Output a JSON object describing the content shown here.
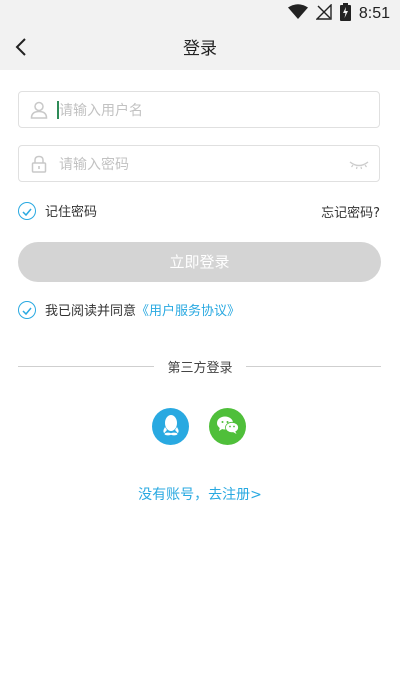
{
  "status_bar": {
    "time": "8:51",
    "icons": [
      "wifi-icon",
      "no-signal-icon",
      "battery-charging-icon"
    ]
  },
  "nav": {
    "title": "登录",
    "back_icon": "chevron-left-icon"
  },
  "username": {
    "placeholder": "请输入用户名",
    "value": "",
    "icon": "user-icon"
  },
  "password": {
    "placeholder": "请输入密码",
    "value": "",
    "icon": "lock-icon",
    "toggle_icon": "eye-closed-icon"
  },
  "remember": {
    "label": "记住密码",
    "checked": true
  },
  "forgot_label": "忘记密码?",
  "login_button_label": "立即登录",
  "agreement": {
    "checked": true,
    "prefix": "我已阅读并同意",
    "link": "《用户服务协议》"
  },
  "third_party": {
    "label": "第三方登录",
    "providers": [
      {
        "name": "QQ",
        "icon": "qq-icon",
        "color": "#29a9e1"
      },
      {
        "name": "WeChat",
        "icon": "wechat-icon",
        "color": "#4fbf3a"
      }
    ]
  },
  "register_label": "没有账号，去注册>",
  "colors": {
    "accent": "#29a9e1",
    "button_disabled": "#d4d4d4",
    "wechat": "#4fbf3a"
  }
}
